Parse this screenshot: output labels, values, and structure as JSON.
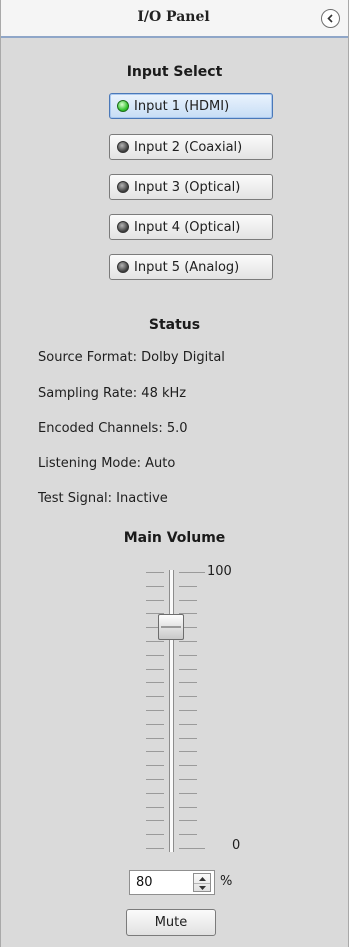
{
  "header": {
    "title": "I/O Panel",
    "collapse_icon": "chevron-left-icon"
  },
  "input_select": {
    "title": "Input Select",
    "inputs": [
      {
        "label": "Input 1 (HDMI)",
        "selected": true
      },
      {
        "label": "Input 2 (Coaxial)",
        "selected": false
      },
      {
        "label": "Input 3 (Optical)",
        "selected": false
      },
      {
        "label": "Input 4 (Optical)",
        "selected": false
      },
      {
        "label": "Input 5 (Analog)",
        "selected": false
      }
    ],
    "colors": {
      "led_on": "#2fc12a",
      "led_off": "#4a4a4a"
    }
  },
  "status": {
    "title": "Status",
    "lines": [
      "Source Format: Dolby Digital",
      "Sampling Rate: 48 kHz",
      "Encoded Channels: 5.0",
      "Listening Mode: Auto",
      "Test Signal: Inactive"
    ]
  },
  "volume": {
    "title": "Main Volume",
    "max_label": "100",
    "min_label": "0",
    "value": "80",
    "level": 80,
    "unit": "%",
    "mute_label": "Mute"
  }
}
